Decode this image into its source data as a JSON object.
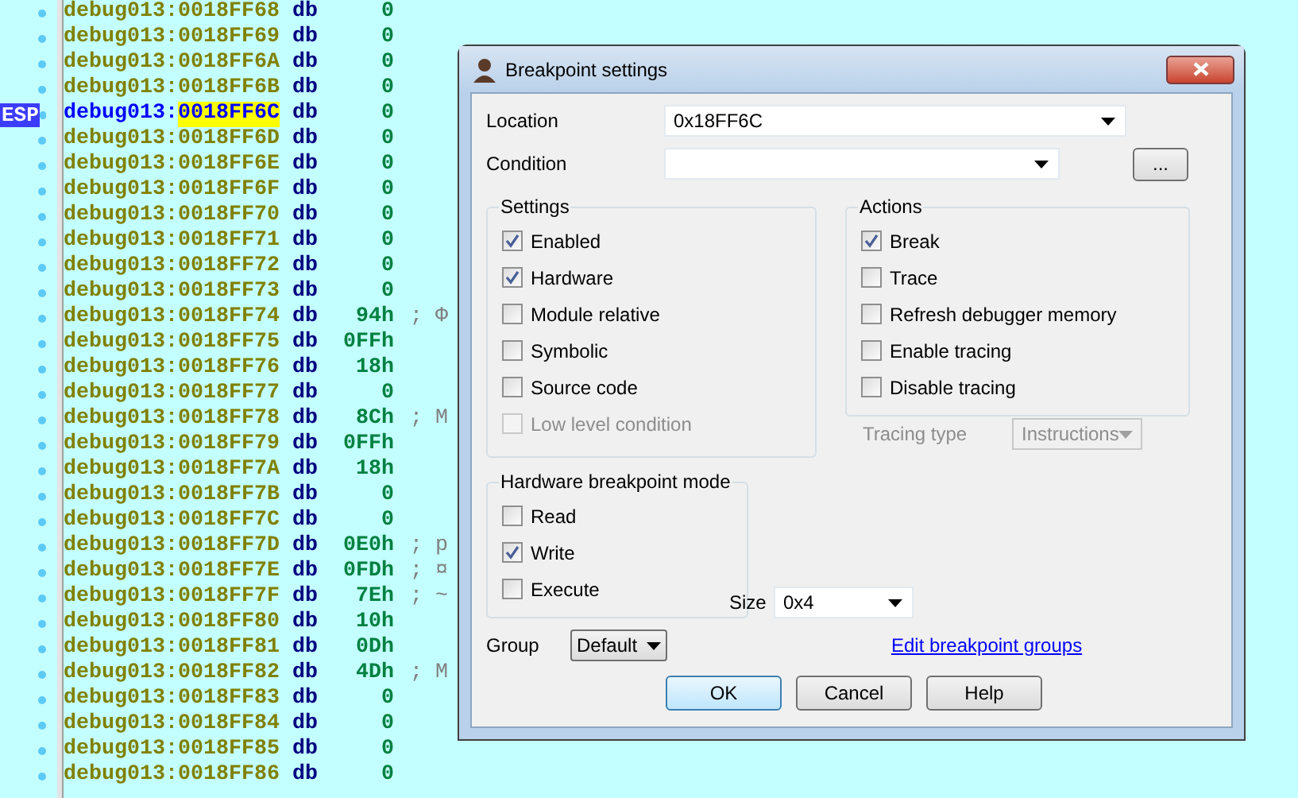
{
  "listing": {
    "rows": [
      {
        "segment": "debug013:",
        "address": "0018FF68",
        "directive": "db",
        "value": "0",
        "selected": false
      },
      {
        "segment": "debug013:",
        "address": "0018FF69",
        "directive": "db",
        "value": "0",
        "selected": false
      },
      {
        "segment": "debug013:",
        "address": "0018FF6A",
        "directive": "db",
        "value": "0",
        "selected": false
      },
      {
        "segment": "debug013:",
        "address": "0018FF6B",
        "directive": "db",
        "value": "0",
        "selected": false
      },
      {
        "segment": "debug013:",
        "address": "0018FF6C",
        "directive": "db",
        "value": "0",
        "selected": true,
        "marker": "ESP"
      },
      {
        "segment": "debug013:",
        "address": "0018FF6D",
        "directive": "db",
        "value": "0",
        "selected": false
      },
      {
        "segment": "debug013:",
        "address": "0018FF6E",
        "directive": "db",
        "value": "0",
        "selected": false
      },
      {
        "segment": "debug013:",
        "address": "0018FF6F",
        "directive": "db",
        "value": "0",
        "selected": false
      },
      {
        "segment": "debug013:",
        "address": "0018FF70",
        "directive": "db",
        "value": "0",
        "selected": false
      },
      {
        "segment": "debug013:",
        "address": "0018FF71",
        "directive": "db",
        "value": "0",
        "selected": false
      },
      {
        "segment": "debug013:",
        "address": "0018FF72",
        "directive": "db",
        "value": "0",
        "selected": false
      },
      {
        "segment": "debug013:",
        "address": "0018FF73",
        "directive": "db",
        "value": "0",
        "selected": false
      },
      {
        "segment": "debug013:",
        "address": "0018FF74",
        "directive": "db",
        "value": "94h",
        "selected": false,
        "comment": "; Φ"
      },
      {
        "segment": "debug013:",
        "address": "0018FF75",
        "directive": "db",
        "value": "0FFh",
        "selected": false
      },
      {
        "segment": "debug013:",
        "address": "0018FF76",
        "directive": "db",
        "value": "18h",
        "selected": false
      },
      {
        "segment": "debug013:",
        "address": "0018FF77",
        "directive": "db",
        "value": "0",
        "selected": false
      },
      {
        "segment": "debug013:",
        "address": "0018FF78",
        "directive": "db",
        "value": "8Ch",
        "selected": false,
        "comment": "; M"
      },
      {
        "segment": "debug013:",
        "address": "0018FF79",
        "directive": "db",
        "value": "0FFh",
        "selected": false
      },
      {
        "segment": "debug013:",
        "address": "0018FF7A",
        "directive": "db",
        "value": "18h",
        "selected": false
      },
      {
        "segment": "debug013:",
        "address": "0018FF7B",
        "directive": "db",
        "value": "0",
        "selected": false
      },
      {
        "segment": "debug013:",
        "address": "0018FF7C",
        "directive": "db",
        "value": "0",
        "selected": false
      },
      {
        "segment": "debug013:",
        "address": "0018FF7D",
        "directive": "db",
        "value": "0E0h",
        "selected": false,
        "comment": "; p"
      },
      {
        "segment": "debug013:",
        "address": "0018FF7E",
        "directive": "db",
        "value": "0FDh",
        "selected": false,
        "comment": "; ¤"
      },
      {
        "segment": "debug013:",
        "address": "0018FF7F",
        "directive": "db",
        "value": "7Eh",
        "selected": false,
        "comment": "; ~"
      },
      {
        "segment": "debug013:",
        "address": "0018FF80",
        "directive": "db",
        "value": "10h",
        "selected": false
      },
      {
        "segment": "debug013:",
        "address": "0018FF81",
        "directive": "db",
        "value": "0Dh",
        "selected": false
      },
      {
        "segment": "debug013:",
        "address": "0018FF82",
        "directive": "db",
        "value": "4Dh",
        "selected": false,
        "comment": "; M"
      },
      {
        "segment": "debug013:",
        "address": "0018FF83",
        "directive": "db",
        "value": "0",
        "selected": false
      },
      {
        "segment": "debug013:",
        "address": "0018FF84",
        "directive": "db",
        "value": "0",
        "selected": false
      },
      {
        "segment": "debug013:",
        "address": "0018FF85",
        "directive": "db",
        "value": "0",
        "selected": false
      },
      {
        "segment": "debug013:",
        "address": "0018FF86",
        "directive": "db",
        "value": "0",
        "selected": false
      }
    ]
  },
  "dialog": {
    "title": "Breakpoint settings",
    "location": {
      "label": "Location",
      "value": "0x18FF6C"
    },
    "condition": {
      "label": "Condition"
    },
    "more_button": "...",
    "settings": {
      "title": "Settings",
      "options": [
        {
          "label": "Enabled",
          "checked": true,
          "disabled": false
        },
        {
          "label": "Hardware",
          "checked": true,
          "disabled": false
        },
        {
          "label": "Module relative",
          "checked": false,
          "disabled": false
        },
        {
          "label": "Symbolic",
          "checked": false,
          "disabled": false
        },
        {
          "label": "Source code",
          "checked": false,
          "disabled": false
        },
        {
          "label": "Low level condition",
          "checked": false,
          "disabled": true
        }
      ]
    },
    "actions": {
      "title": "Actions",
      "options": [
        {
          "label": "Break",
          "checked": true,
          "disabled": false
        },
        {
          "label": "Trace",
          "checked": false,
          "disabled": false
        },
        {
          "label": "Refresh debugger memory",
          "checked": false,
          "disabled": false
        },
        {
          "label": "Enable tracing",
          "checked": false,
          "disabled": false
        },
        {
          "label": "Disable tracing",
          "checked": false,
          "disabled": false
        }
      ]
    },
    "tracing_type": {
      "label": "Tracing type",
      "value": "Instructions",
      "disabled": true
    },
    "hardware_mode": {
      "title": "Hardware breakpoint mode",
      "options": [
        {
          "label": "Read",
          "checked": false,
          "disabled": false
        },
        {
          "label": "Write",
          "checked": true,
          "disabled": false
        },
        {
          "label": "Execute",
          "checked": false,
          "disabled": false
        }
      ]
    },
    "size": {
      "label": "Size",
      "value": "0x4"
    },
    "group": {
      "label": "Group",
      "value": "Default"
    },
    "link": "Edit breakpoint groups",
    "buttons": [
      {
        "label": "OK",
        "default": true
      },
      {
        "label": "Cancel",
        "default": false
      },
      {
        "label": "Help",
        "default": false
      }
    ]
  }
}
